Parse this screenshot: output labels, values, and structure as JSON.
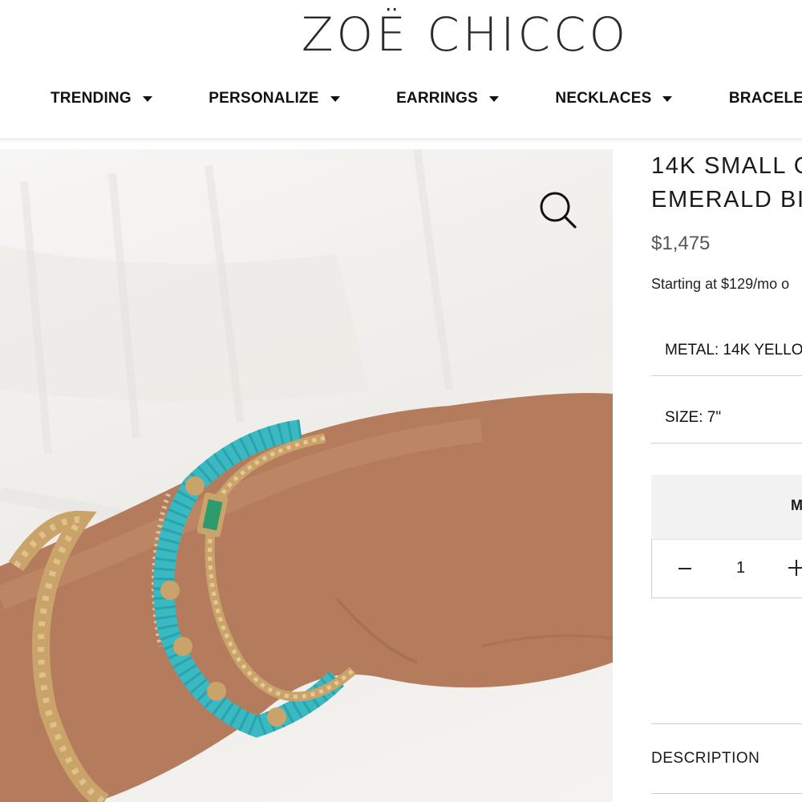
{
  "brand": {
    "logo_text": "ZOË CHICCO"
  },
  "nav": {
    "items": [
      {
        "label": "TRENDING"
      },
      {
        "label": "PERSONALIZE"
      },
      {
        "label": "EARRINGS"
      },
      {
        "label": "NECKLACES"
      },
      {
        "label": "BRACELETS"
      }
    ]
  },
  "product": {
    "title_line1": "14K SMALL C",
    "title_line2": "EMERALD BI",
    "price": "$1,475",
    "financing": "Starting at $129/mo o",
    "metal_label": "METAL: 14K YELLO",
    "size_label": "SIZE: 7\"",
    "gray_box_text": "M",
    "quantity": "1",
    "description_label": "DESCRIPTION"
  },
  "colors": {
    "turquoise": "#39b9c2",
    "gold": "#c9a36a",
    "skin": "#b47c5c",
    "shirt": "#f4f3f1"
  },
  "icons": {
    "zoom": "magnifier-icon",
    "dropdown": "caret-down-icon",
    "minus": "minus-icon",
    "plus": "plus-icon"
  }
}
